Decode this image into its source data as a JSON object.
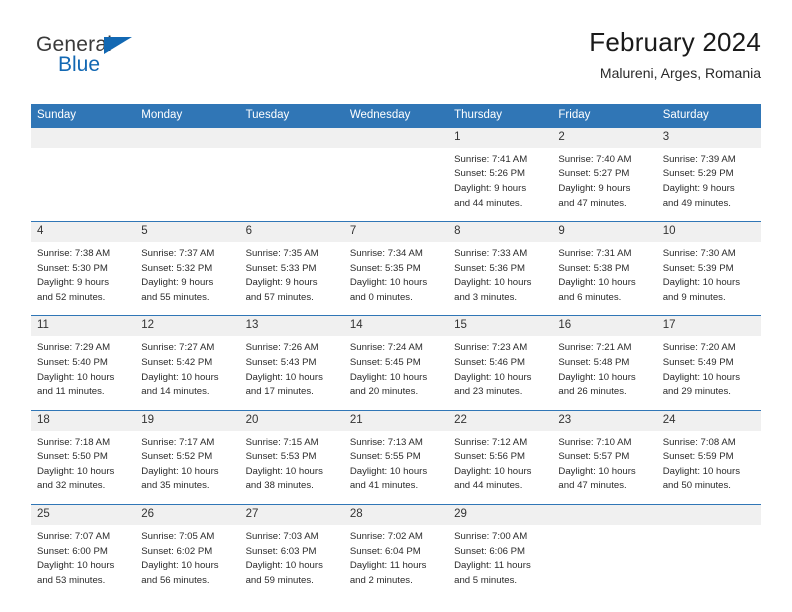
{
  "brand": {
    "name_top": "General",
    "name_bottom": "Blue",
    "triangle_color": "#1268b3",
    "top_color": "#3a3a3a"
  },
  "header": {
    "title": "February 2024",
    "subtitle": "Malureni, Arges, Romania"
  },
  "theme": {
    "header_blue": "#3076B6",
    "daynum_band": "#F0F0F0",
    "text": "#2b2b2b"
  },
  "weekdays": [
    "Sunday",
    "Monday",
    "Tuesday",
    "Wednesday",
    "Thursday",
    "Friday",
    "Saturday"
  ],
  "weeks": [
    [
      {
        "day": "",
        "blank": true
      },
      {
        "day": "",
        "blank": true
      },
      {
        "day": "",
        "blank": true
      },
      {
        "day": "",
        "blank": true
      },
      {
        "day": "1",
        "sunrise": "Sunrise: 7:41 AM",
        "sunset": "Sunset: 5:26 PM",
        "daylight1": "Daylight: 9 hours",
        "daylight2": "and 44 minutes."
      },
      {
        "day": "2",
        "sunrise": "Sunrise: 7:40 AM",
        "sunset": "Sunset: 5:27 PM",
        "daylight1": "Daylight: 9 hours",
        "daylight2": "and 47 minutes."
      },
      {
        "day": "3",
        "sunrise": "Sunrise: 7:39 AM",
        "sunset": "Sunset: 5:29 PM",
        "daylight1": "Daylight: 9 hours",
        "daylight2": "and 49 minutes."
      }
    ],
    [
      {
        "day": "4",
        "sunrise": "Sunrise: 7:38 AM",
        "sunset": "Sunset: 5:30 PM",
        "daylight1": "Daylight: 9 hours",
        "daylight2": "and 52 minutes."
      },
      {
        "day": "5",
        "sunrise": "Sunrise: 7:37 AM",
        "sunset": "Sunset: 5:32 PM",
        "daylight1": "Daylight: 9 hours",
        "daylight2": "and 55 minutes."
      },
      {
        "day": "6",
        "sunrise": "Sunrise: 7:35 AM",
        "sunset": "Sunset: 5:33 PM",
        "daylight1": "Daylight: 9 hours",
        "daylight2": "and 57 minutes."
      },
      {
        "day": "7",
        "sunrise": "Sunrise: 7:34 AM",
        "sunset": "Sunset: 5:35 PM",
        "daylight1": "Daylight: 10 hours",
        "daylight2": "and 0 minutes."
      },
      {
        "day": "8",
        "sunrise": "Sunrise: 7:33 AM",
        "sunset": "Sunset: 5:36 PM",
        "daylight1": "Daylight: 10 hours",
        "daylight2": "and 3 minutes."
      },
      {
        "day": "9",
        "sunrise": "Sunrise: 7:31 AM",
        "sunset": "Sunset: 5:38 PM",
        "daylight1": "Daylight: 10 hours",
        "daylight2": "and 6 minutes."
      },
      {
        "day": "10",
        "sunrise": "Sunrise: 7:30 AM",
        "sunset": "Sunset: 5:39 PM",
        "daylight1": "Daylight: 10 hours",
        "daylight2": "and 9 minutes."
      }
    ],
    [
      {
        "day": "11",
        "sunrise": "Sunrise: 7:29 AM",
        "sunset": "Sunset: 5:40 PM",
        "daylight1": "Daylight: 10 hours",
        "daylight2": "and 11 minutes."
      },
      {
        "day": "12",
        "sunrise": "Sunrise: 7:27 AM",
        "sunset": "Sunset: 5:42 PM",
        "daylight1": "Daylight: 10 hours",
        "daylight2": "and 14 minutes."
      },
      {
        "day": "13",
        "sunrise": "Sunrise: 7:26 AM",
        "sunset": "Sunset: 5:43 PM",
        "daylight1": "Daylight: 10 hours",
        "daylight2": "and 17 minutes."
      },
      {
        "day": "14",
        "sunrise": "Sunrise: 7:24 AM",
        "sunset": "Sunset: 5:45 PM",
        "daylight1": "Daylight: 10 hours",
        "daylight2": "and 20 minutes."
      },
      {
        "day": "15",
        "sunrise": "Sunrise: 7:23 AM",
        "sunset": "Sunset: 5:46 PM",
        "daylight1": "Daylight: 10 hours",
        "daylight2": "and 23 minutes."
      },
      {
        "day": "16",
        "sunrise": "Sunrise: 7:21 AM",
        "sunset": "Sunset: 5:48 PM",
        "daylight1": "Daylight: 10 hours",
        "daylight2": "and 26 minutes."
      },
      {
        "day": "17",
        "sunrise": "Sunrise: 7:20 AM",
        "sunset": "Sunset: 5:49 PM",
        "daylight1": "Daylight: 10 hours",
        "daylight2": "and 29 minutes."
      }
    ],
    [
      {
        "day": "18",
        "sunrise": "Sunrise: 7:18 AM",
        "sunset": "Sunset: 5:50 PM",
        "daylight1": "Daylight: 10 hours",
        "daylight2": "and 32 minutes."
      },
      {
        "day": "19",
        "sunrise": "Sunrise: 7:17 AM",
        "sunset": "Sunset: 5:52 PM",
        "daylight1": "Daylight: 10 hours",
        "daylight2": "and 35 minutes."
      },
      {
        "day": "20",
        "sunrise": "Sunrise: 7:15 AM",
        "sunset": "Sunset: 5:53 PM",
        "daylight1": "Daylight: 10 hours",
        "daylight2": "and 38 minutes."
      },
      {
        "day": "21",
        "sunrise": "Sunrise: 7:13 AM",
        "sunset": "Sunset: 5:55 PM",
        "daylight1": "Daylight: 10 hours",
        "daylight2": "and 41 minutes."
      },
      {
        "day": "22",
        "sunrise": "Sunrise: 7:12 AM",
        "sunset": "Sunset: 5:56 PM",
        "daylight1": "Daylight: 10 hours",
        "daylight2": "and 44 minutes."
      },
      {
        "day": "23",
        "sunrise": "Sunrise: 7:10 AM",
        "sunset": "Sunset: 5:57 PM",
        "daylight1": "Daylight: 10 hours",
        "daylight2": "and 47 minutes."
      },
      {
        "day": "24",
        "sunrise": "Sunrise: 7:08 AM",
        "sunset": "Sunset: 5:59 PM",
        "daylight1": "Daylight: 10 hours",
        "daylight2": "and 50 minutes."
      }
    ],
    [
      {
        "day": "25",
        "sunrise": "Sunrise: 7:07 AM",
        "sunset": "Sunset: 6:00 PM",
        "daylight1": "Daylight: 10 hours",
        "daylight2": "and 53 minutes."
      },
      {
        "day": "26",
        "sunrise": "Sunrise: 7:05 AM",
        "sunset": "Sunset: 6:02 PM",
        "daylight1": "Daylight: 10 hours",
        "daylight2": "and 56 minutes."
      },
      {
        "day": "27",
        "sunrise": "Sunrise: 7:03 AM",
        "sunset": "Sunset: 6:03 PM",
        "daylight1": "Daylight: 10 hours",
        "daylight2": "and 59 minutes."
      },
      {
        "day": "28",
        "sunrise": "Sunrise: 7:02 AM",
        "sunset": "Sunset: 6:04 PM",
        "daylight1": "Daylight: 11 hours",
        "daylight2": "and 2 minutes."
      },
      {
        "day": "29",
        "sunrise": "Sunrise: 7:00 AM",
        "sunset": "Sunset: 6:06 PM",
        "daylight1": "Daylight: 11 hours",
        "daylight2": "and 5 minutes."
      },
      {
        "day": "",
        "blank": true
      },
      {
        "day": "",
        "blank": true
      }
    ]
  ]
}
